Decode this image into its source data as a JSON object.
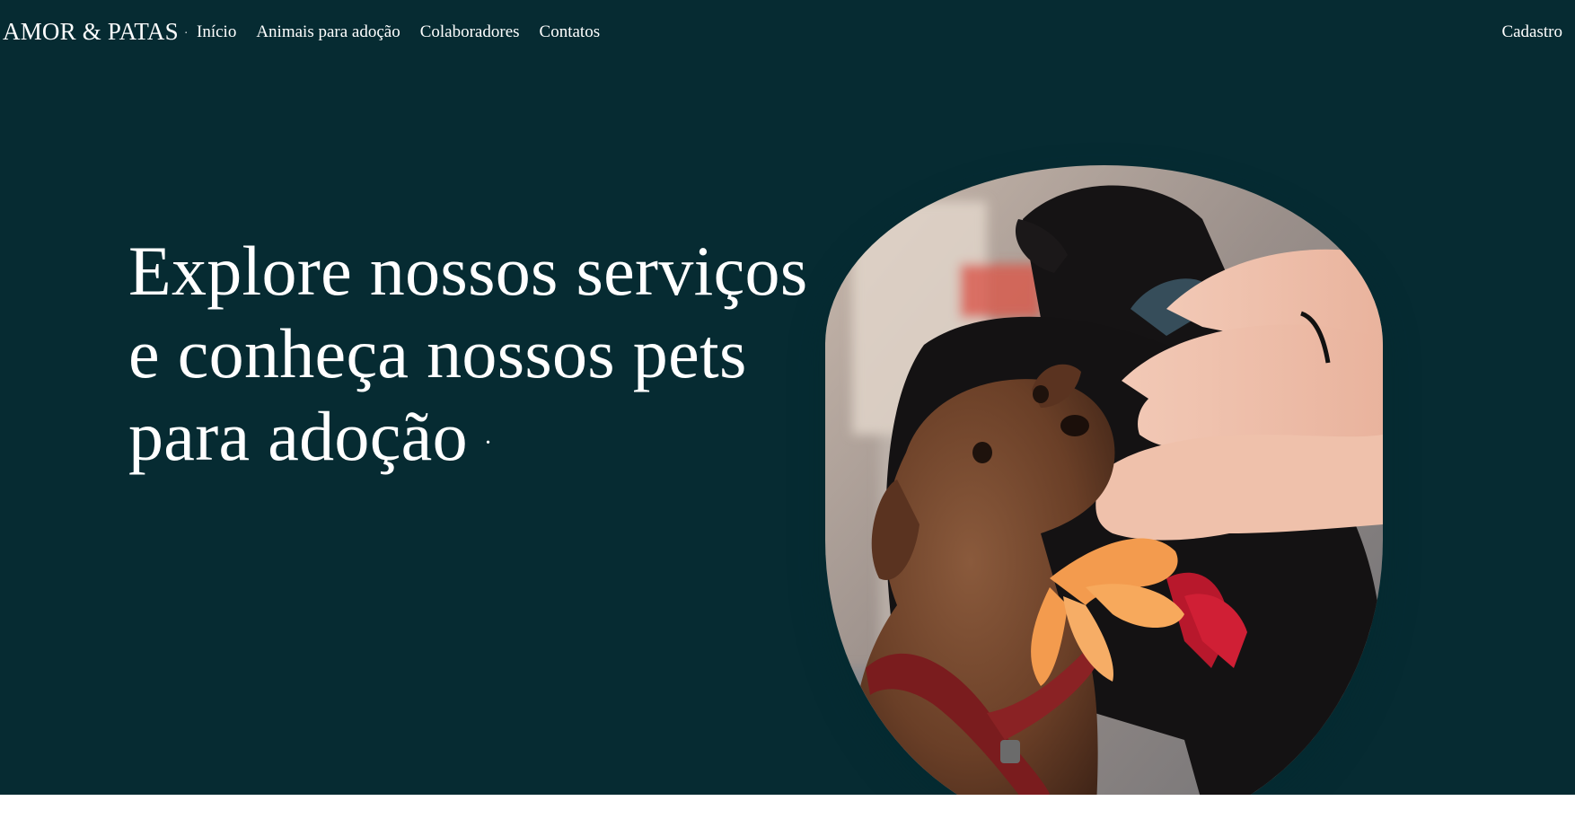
{
  "brand": {
    "name": "AMOR & PATAS",
    "dot": "·"
  },
  "nav": {
    "items": [
      {
        "label": "Início"
      },
      {
        "label": "Animais para adoção"
      },
      {
        "label": "Colaboradores"
      },
      {
        "label": "Contatos"
      }
    ],
    "signup_label": "Cadastro"
  },
  "hero": {
    "headline_lines": [
      "Explore nossos serviços",
      "e conheça nossos pets",
      "para adoção"
    ],
    "headline_dot": "·",
    "image_alt": "dog-with-orange-ribbon-photo"
  },
  "colors": {
    "hero_background": "#062b32",
    "text": "#ffffff",
    "page_background": "#ffffff"
  }
}
